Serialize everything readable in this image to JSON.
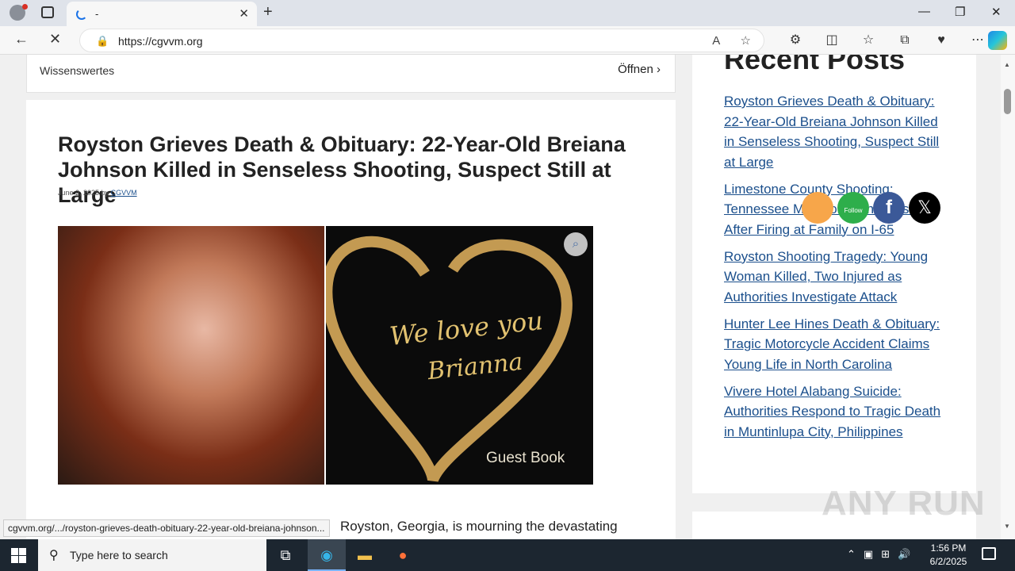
{
  "browser": {
    "tab_title": "-",
    "url": "https://cgvvm.org",
    "status_url": "cgvvm.org/.../royston-grieves-death-obituary-22-year-old-breiana-johnson..."
  },
  "top_bar": {
    "label": "Wissenswertes",
    "open_label": "Öffnen"
  },
  "article": {
    "title": "Royston Grieves Death & Obituary: 22-Year-Old Breiana Johnson Killed in Senseless Shooting, Suspect Still at Large",
    "date": "June 2, 2025",
    "by": "by",
    "author": "CGVVM",
    "image_text_1": "We love you",
    "image_text_2": "Brianna",
    "image_text_3": "Guest Book",
    "body_start": "Royston, Georgia, is mourning the devastating"
  },
  "sidebar": {
    "heading": "Recent Posts",
    "posts": [
      "Royston Grieves Death & Obituary: 22-Year-Old Breiana Johnson Killed in Senseless Shooting, Suspect Still at Large",
      "Limestone County Shooting: Tennessee Man Johnson Arrested After Firing at Family on I-65",
      "Royston Shooting Tragedy: Young Woman Killed, Two Injured as Authorities Investigate Attack",
      "Hunter Lee Hines Death & Obituary: Tragic Motorcycle Accident Claims Young Life in North Carolina",
      "Vivere Hotel Alabang Suicide: Authorities Respond to Tragic Death in Muntinlupa City, Philippines"
    ],
    "social": {
      "follow_label": "Follow",
      "colors": {
        "rss": "#f7a64a",
        "follow": "#2eae4b",
        "facebook": "#3b5998",
        "x": "#000000"
      }
    }
  },
  "watermark": "ANY RUN",
  "taskbar": {
    "search_placeholder": "Type here to search",
    "time": "1:56 PM",
    "date": "6/2/2025"
  }
}
